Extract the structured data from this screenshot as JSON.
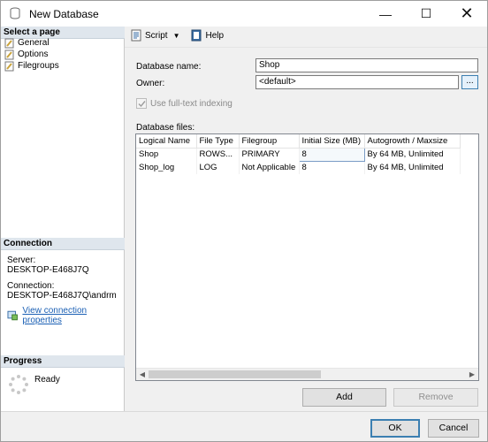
{
  "window": {
    "title": "New Database"
  },
  "left_pane": {
    "select_page_header": "Select a page",
    "pages": [
      {
        "label": "General"
      },
      {
        "label": "Options"
      },
      {
        "label": "Filegroups"
      }
    ],
    "connection_header": "Connection",
    "server_label": "Server:",
    "server_value": "DESKTOP-E468J7Q",
    "connection_label": "Connection:",
    "connection_value": "DESKTOP-E468J7Q\\andrm",
    "view_connection_link": "View connection properties",
    "progress_header": "Progress",
    "progress_status": "Ready"
  },
  "toolbar": {
    "script_label": "Script",
    "help_label": "Help"
  },
  "form": {
    "database_name_label": "Database name:",
    "database_name_value": "Shop",
    "owner_label": "Owner:",
    "owner_value": "<default>",
    "browse_label": "...",
    "fulltext_label": "Use full-text indexing",
    "fulltext_checked": true,
    "database_files_label": "Database files:"
  },
  "files_table": {
    "columns": [
      "Logical Name",
      "File Type",
      "Filegroup",
      "Initial Size (MB)",
      "Autogrowth / Maxsize"
    ],
    "rows": [
      [
        "Shop",
        "ROWS...",
        "PRIMARY",
        "8",
        "By 64 MB, Unlimited"
      ],
      [
        "Shop_log",
        "LOG",
        "Not Applicable",
        "8",
        "By 64 MB, Unlimited"
      ]
    ]
  },
  "buttons": {
    "add": "Add",
    "remove": "Remove",
    "ok": "OK",
    "cancel": "Cancel"
  }
}
